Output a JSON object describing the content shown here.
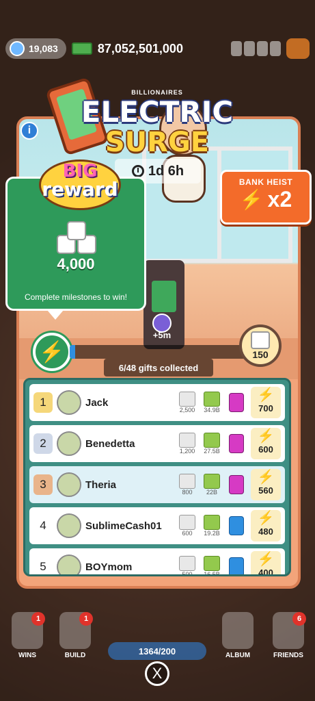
{
  "top_bar": {
    "cash_value": "19,083",
    "net_worth": "87,052,501,000"
  },
  "event": {
    "title_line1": "ELECTRIC",
    "title_line2": "SURGE",
    "banner_small": "BILLIONAIRES",
    "timer": "1d 6h",
    "info_label": "i"
  },
  "bank_heist": {
    "title": "BANK HEIST",
    "multiplier": "x2"
  },
  "big_reward": {
    "badge_line1": "BIG",
    "badge_line2": "reward",
    "amount": "4,000",
    "description": "Complete milestones to win!"
  },
  "progress": {
    "fraction": 0.03,
    "milestone_label": "+5m",
    "next_prize_value": "150",
    "gifts_collected": "6/48 gifts collected"
  },
  "leaderboard": [
    {
      "rank": "1",
      "name": "Jack",
      "dice": "2,500",
      "cash": "34.9B",
      "points": "700",
      "sticker": "pink",
      "medal": "gold"
    },
    {
      "rank": "2",
      "name": "Benedetta",
      "dice": "1,200",
      "cash": "27.5B",
      "points": "600",
      "sticker": "pink",
      "medal": "silver"
    },
    {
      "rank": "3",
      "name": "Theria",
      "dice": "800",
      "cash": "22B",
      "points": "560",
      "sticker": "pink",
      "medal": "bronze"
    },
    {
      "rank": "4",
      "name": "SublimeCash01",
      "dice": "600",
      "cash": "19.2B",
      "points": "480",
      "sticker": "blue",
      "medal": "none"
    },
    {
      "rank": "5",
      "name": "BOYmom",
      "dice": "500",
      "cash": "16.5B",
      "points": "400",
      "sticker": "blue",
      "medal": "none"
    }
  ],
  "bottom_nav": {
    "wins_label": "WINS",
    "wins_badge": "1",
    "build_label": "BUILD",
    "build_badge": "1",
    "album_label": "ALBUM",
    "friends_label": "FRIENDS",
    "friends_badge": "6",
    "center_pill": "1364/200",
    "close_symbol": "X"
  },
  "colors": {
    "panel_green": "#2e9a5a",
    "heist_orange": "#f36b2a",
    "board_teal": "#3f8f84",
    "bolt_yellow": "#f5b91c"
  }
}
